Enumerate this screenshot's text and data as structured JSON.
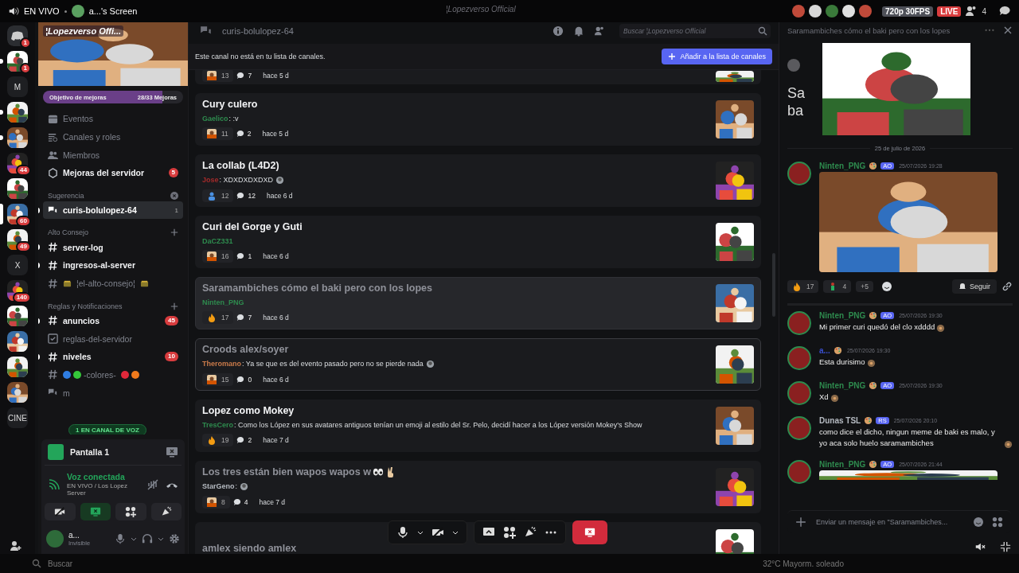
{
  "window": {
    "title": "¦Lopezverso Official"
  },
  "stream_bar": {
    "live_label": "EN VIVO",
    "screen_name": "a...'s Screen",
    "quality": "720p 30FPS",
    "live_badge": "LIVE",
    "viewers": "4"
  },
  "server_rail": [
    {
      "kind": "home",
      "badge": "1",
      "unread": false,
      "selected": false
    },
    {
      "kind": "avatar",
      "badge": "1",
      "unread": true,
      "selected": false
    },
    {
      "kind": "letter",
      "label": "M",
      "unread": false,
      "selected": false
    },
    {
      "kind": "avatar",
      "unread": true,
      "selected": false
    },
    {
      "kind": "avatar",
      "unread": true,
      "selected": false
    },
    {
      "kind": "avatar",
      "badge": "44",
      "unread": false,
      "selected": false
    },
    {
      "kind": "avatar",
      "unread": false,
      "selected": false
    },
    {
      "kind": "avatar",
      "badge": "60",
      "unread": false,
      "selected": true
    },
    {
      "kind": "avatar",
      "badge": "49",
      "unread": false,
      "selected": false
    },
    {
      "kind": "letter",
      "label": "X",
      "unread": false,
      "selected": false
    },
    {
      "kind": "avatar",
      "badge": "140",
      "unread": false,
      "selected": false
    },
    {
      "kind": "avatar",
      "unread": false,
      "selected": false
    },
    {
      "kind": "avatar",
      "unread": false,
      "selected": false
    },
    {
      "kind": "avatar",
      "unread": false,
      "selected": false
    },
    {
      "kind": "avatar",
      "unread": false,
      "selected": false
    },
    {
      "kind": "letter",
      "label": "CINE",
      "unread": false,
      "selected": false
    }
  ],
  "server": {
    "name": "¦Lopezverso Offi...",
    "boost_goal": {
      "label": "Objetivo de mejoras",
      "progress": "28/33 Mejoras",
      "level": 0.85
    }
  },
  "nav": [
    {
      "kind": "events",
      "label": "Eventos",
      "unread": false
    },
    {
      "kind": "channels",
      "label": "Canales y roles",
      "unread": false
    },
    {
      "kind": "members",
      "label": "Miembros",
      "unread": false
    },
    {
      "kind": "boosts",
      "label": "Mejoras del servidor",
      "unread": true,
      "badge": "5"
    }
  ],
  "categories": [
    {
      "name": "Sugerencia",
      "kind": "dismissable",
      "channels": [
        {
          "kind": "forum",
          "name": "curis-bolulopez-64",
          "unread": true,
          "selected": true,
          "decorated": false,
          "count": "1"
        }
      ]
    },
    {
      "name": "Alto Consejo",
      "kind": "collapsible",
      "channels": [
        {
          "kind": "text",
          "name": "server-log",
          "unread": true,
          "selected": false,
          "decorated": false
        },
        {
          "kind": "text",
          "name": "ingresos-al-server",
          "unread": true,
          "selected": false,
          "decorated": false
        },
        {
          "kind": "text",
          "name": "¦el-alto-consejo¦",
          "unread": false,
          "selected": false,
          "decorated": true
        }
      ]
    },
    {
      "name": "Reglas y Notificaciones",
      "kind": "collapsible",
      "channels": [
        {
          "kind": "text",
          "name": "anuncios",
          "unread": true,
          "selected": false,
          "decorated": false,
          "badge": "45"
        },
        {
          "kind": "rules",
          "name": "reglas-del-servidor",
          "unread": false,
          "selected": false,
          "decorated": false
        },
        {
          "kind": "text",
          "name": "niveles",
          "unread": true,
          "selected": false,
          "decorated": false,
          "badge": "10"
        },
        {
          "kind": "text",
          "name": "-colores-",
          "unread": false,
          "selected": false,
          "decorated": false,
          "dots_before": [
            {
              "color": "#2f7de1"
            },
            {
              "color": "#35c73a"
            }
          ],
          "dots_after": [
            {
              "color": "#e0283a"
            },
            {
              "color": "#f07a1c"
            }
          ]
        },
        {
          "kind": "forum",
          "name": "m",
          "unread": false,
          "selected": false,
          "decorated": false
        }
      ]
    }
  ],
  "voice_pill": "1 EN CANAL DE VOZ",
  "stream_panel": {
    "title": "Pantalla 1"
  },
  "voice": {
    "status": "Voz conectada",
    "location": "EN VIVO / Los Lopez Server"
  },
  "call_buttons": [
    {
      "kind": "camera_off",
      "selected": false
    },
    {
      "kind": "screen",
      "selected": true
    },
    {
      "kind": "activities",
      "selected": false
    },
    {
      "kind": "soundboard",
      "selected": false
    }
  ],
  "user": {
    "name": "a...",
    "status": "Invisible"
  },
  "main": {
    "channel_name": "curis-bolulopez-64",
    "search_placeholder": "Buscar ¦Lopezverso Official",
    "notice": "Este canal no está en tu lista de canales.",
    "add_button": "Añadir a la lista de canales"
  },
  "posts": [
    {
      "reaction": {
        "kind": "avatar",
        "count": "13"
      },
      "replies": "7",
      "time": "hace 5 d",
      "selected": false,
      "hovered": false
    },
    {
      "title": "Cury culero",
      "author": "Gaelico",
      "color": "#2e8b4e",
      "message": ": :v",
      "reaction": {
        "kind": "avatar",
        "count": "11"
      },
      "replies": "2",
      "time": "hace 5 d",
      "read": false,
      "selected": false,
      "hovered": false
    },
    {
      "title": "La collab (L4D2)",
      "author": "Jose",
      "color": "#a32a2a",
      "message": ": XDXDXDXDXD",
      "message_emoji": true,
      "reaction": {
        "kind": "person",
        "count": "12"
      },
      "replies": "12",
      "time": "hace 6 d",
      "read": false,
      "selected": false,
      "hovered": false
    },
    {
      "title": "Curi del Gorge y Guti",
      "author": "DaCZ331",
      "color": "#2e8b4e",
      "reaction": {
        "kind": "avatar",
        "count": "16"
      },
      "replies": "1",
      "time": "hace 6 d",
      "read": false,
      "selected": false,
      "hovered": false
    },
    {
      "title": "Saramambiches cómo el baki pero con los lopes",
      "author": "Ninten_PNG",
      "color": "#2e8b4e",
      "reaction": {
        "kind": "fire",
        "count": "17"
      },
      "replies": "7",
      "time": "hace 6 d",
      "read": true,
      "selected": true,
      "hovered": false
    },
    {
      "title": "Croods alex/soyer",
      "author": "Theromano",
      "color": "#c97a4a",
      "message": ": Ya se que es del evento pasado pero no se pierde nada",
      "message_emoji": true,
      "reaction": {
        "kind": "avatar",
        "count": "15"
      },
      "replies": "0",
      "time": "hace 6 d",
      "read": true,
      "selected": false,
      "hovered": true
    },
    {
      "title": "Lopez como Mokey",
      "author": "TresCero",
      "color": "#2e8b4e",
      "message": ": Como los López en sus avatares antiguos tenían un emoji al estilo del Sr. Pelo, decidí hacer a los López versión Mokey's Show",
      "reaction": {
        "kind": "fire",
        "count": "19"
      },
      "replies": "2",
      "time": "hace 7 d",
      "read": false,
      "selected": false,
      "hovered": false
    },
    {
      "title": "Los tres están bien wapos wapos w",
      "title_emoji": true,
      "author": "StarGeno",
      "color": "#b5bac1",
      "message": ":",
      "message_emoji": true,
      "reaction": {
        "kind": "avatar",
        "count": "8"
      },
      "replies": "4",
      "time": "hace 7 d",
      "read": true,
      "selected": false,
      "hovered": false
    },
    {
      "title": "amlex siendo amlex",
      "read": true,
      "selected": false,
      "hovered": false
    }
  ],
  "thread": {
    "title": "Saramambiches cómo el baki pero con los lopes",
    "heading_fragments": [
      "Sa",
      "ba"
    ],
    "date": "25 de julio de 2026",
    "messages": [
      {
        "author": "Ninten_PNG",
        "color": "#2e8b4e",
        "tag": "AO",
        "time": "25/07/2026 19:28",
        "reactions": [
          {
            "kind": "fire",
            "count": "17"
          },
          {
            "kind": "figure",
            "count": "4"
          }
        ],
        "more": "+5",
        "follow": "Seguir"
      },
      {
        "kind": "text",
        "author": "Ninten_PNG",
        "color": "#2e8b4e",
        "tag": "AO",
        "time": "25/07/2026 19:30",
        "text": "Mi primer curi quedó del clo xdddd"
      },
      {
        "kind": "text",
        "author": "a...",
        "color": "#3a4fd0",
        "time": "25/07/2026 19:30",
        "text": "Esta durisimo"
      },
      {
        "kind": "text",
        "author": "Ninten_PNG",
        "color": "#2e8b4e",
        "tag": "AO",
        "time": "25/07/2026 19:30",
        "text": "Xd"
      },
      {
        "kind": "text",
        "author": "Dunas TSL",
        "color": "#b5bac1",
        "tag": "RS",
        "time": "25/07/2026 20:10",
        "text": "como dice el dicho, ningun meme de baki es malo, y yo aca solo huelo saramambiches"
      },
      {
        "author": "Ninten_PNG",
        "color": "#2e8b4e",
        "tag": "AO",
        "time": "25/07/2026 21:44"
      }
    ],
    "input_placeholder": "Enviar un mensaje en \"Saramambiches..."
  },
  "taskbar": {
    "search": "Buscar",
    "weather": "32°C Mayorm. soleado"
  }
}
